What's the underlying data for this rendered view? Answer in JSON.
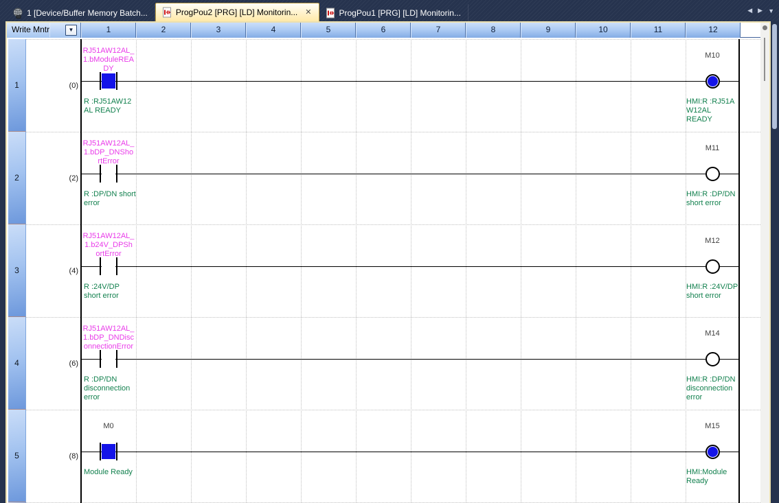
{
  "tab_bar": {
    "tabs": [
      {
        "name": "tab-device-buffer-memory-batch",
        "label": "1 [Device/Buffer Memory Batch...",
        "icon": "device-buffer-memory-icon",
        "active": false,
        "closable": false
      },
      {
        "name": "tab-progpou2-monitoring",
        "label": "ProgPou2 [PRG] [LD] Monitorin...",
        "icon": "ladder-program-icon",
        "active": true,
        "closable": true,
        "close_glyph": "✕"
      },
      {
        "name": "tab-progpou1-monitoring",
        "label": "ProgPou1 [PRG] [LD] Monitorin...",
        "icon": "ladder-program-icon",
        "active": false,
        "closable": false
      }
    ],
    "scroll_left_glyph": "◀",
    "scroll_right_glyph": "▶",
    "menu_glyph": "▼"
  },
  "header": {
    "mode_label": "Write Mntr",
    "dropdown_glyph": "▼",
    "columns": [
      "1",
      "2",
      "3",
      "4",
      "5",
      "6",
      "7",
      "8",
      "9",
      "10",
      "11",
      "12"
    ]
  },
  "rungs": [
    {
      "row_no": "1",
      "step_no": "(0)",
      "contact": {
        "device": "RJ51AW12AL_1.bModuleREADY",
        "label_lines": "RJ51AW12AL_\n1.bModuleREA\nDY",
        "label_style": "label",
        "comment": "R :RJ51AW12\nAL READY",
        "on": true
      },
      "coil": {
        "device": "M10",
        "comment": "HMI:R :RJ51A\nW12AL\nREADY",
        "on": true
      }
    },
    {
      "row_no": "2",
      "step_no": "(2)",
      "contact": {
        "device": "RJ51AW12AL_1.bDP_DNShortError",
        "label_lines": "RJ51AW12AL_\n1.bDP_DNSho\nrtError",
        "label_style": "label",
        "comment": "R :DP/DN short\nerror",
        "on": false
      },
      "coil": {
        "device": "M11",
        "comment": "HMI:R :DP/DN\nshort error",
        "on": false
      }
    },
    {
      "row_no": "3",
      "step_no": "(4)",
      "contact": {
        "device": "RJ51AW12AL_1.b24V_DPShortError",
        "label_lines": "RJ51AW12AL_\n1.b24V_DPSh\nortError",
        "label_style": "label",
        "comment": "R :24V/DP\nshort error",
        "on": false
      },
      "coil": {
        "device": "M12",
        "comment": "HMI:R :24V/DP\nshort error",
        "on": false
      }
    },
    {
      "row_no": "4",
      "step_no": "(6)",
      "contact": {
        "device": "RJ51AW12AL_1.bDP_DNDisconnectionError",
        "label_lines": "RJ51AW12AL_\n1.bDP_DNDisc\nonnectionError",
        "label_style": "label",
        "comment": "R :DP/DN\ndisconnection\nerror",
        "on": false
      },
      "coil": {
        "device": "M14",
        "comment": "HMI:R :DP/DN\ndisconnection\nerror",
        "on": false
      }
    },
    {
      "row_no": "5",
      "step_no": "(8)",
      "contact": {
        "device": "M0",
        "label_lines": "M0",
        "label_style": "device",
        "comment": "Module Ready",
        "on": true
      },
      "coil": {
        "device": "M15",
        "comment": "HMI:Module\nReady",
        "on": true
      }
    }
  ],
  "colors": {
    "energized_blue": "#1414E8",
    "label_magenta": "#E93BE9",
    "device_gray": "#3F3F3F",
    "comment_green": "#12804E",
    "tab_bar_navy": "#26334E",
    "active_tab_cream": "#FFE9A8",
    "header_blue": "#84ACE5"
  }
}
